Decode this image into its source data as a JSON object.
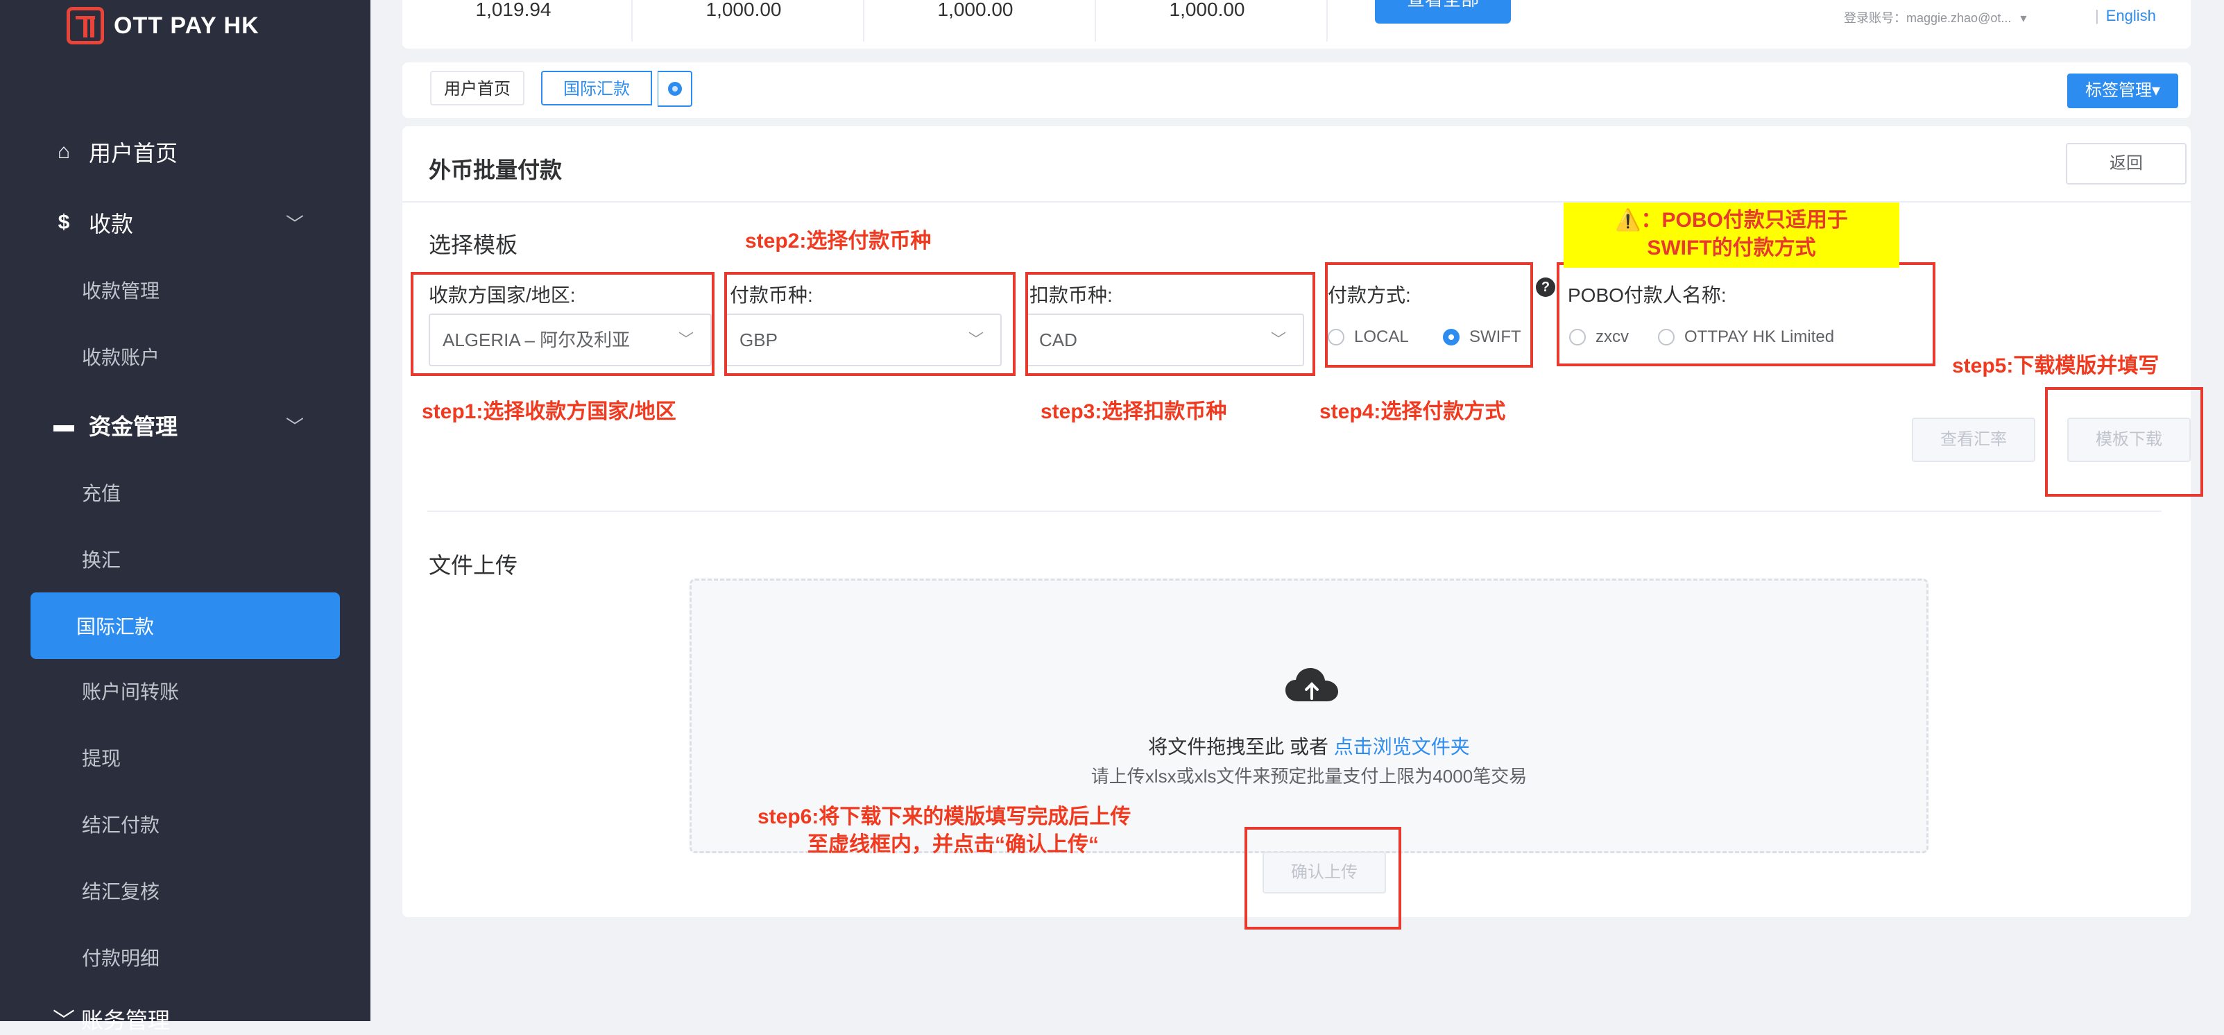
{
  "brand": {
    "name": "OTT PAY HK"
  },
  "sidebar": {
    "groups": [
      {
        "label": "用户首页",
        "icon": "home-icon"
      },
      {
        "label": "收款",
        "icon": "dollar-icon"
      },
      {
        "label": "资金管理",
        "icon": "card-icon"
      },
      {
        "label": "账务管理",
        "icon": "chevron-down-icon"
      }
    ],
    "receive_items": [
      "收款管理",
      "收款账户"
    ],
    "fund_items": [
      "充值",
      "换汇",
      "国际汇款",
      "账户间转账",
      "提现",
      "结汇付款",
      "结汇复核",
      "付款明细"
    ],
    "active": "国际汇款"
  },
  "topbar": {
    "values": [
      "1,019.94",
      "1,000.00",
      "1,000.00",
      "1,000.00"
    ],
    "view_all": "查看全部",
    "account": "登录账号：maggie.zhao@ot...",
    "language": "English"
  },
  "tabs": {
    "items": [
      "用户首页",
      "国际汇款"
    ],
    "tag_manage": "标签管理▾"
  },
  "page": {
    "title": "外币批量付款",
    "back": "返回",
    "select_template": "选择模板",
    "fields": {
      "country_label": "收款方国家/地区:",
      "country_value": "ALGERIA – 阿尔及利亚",
      "pay_currency_label": "付款币种:",
      "pay_currency_value": "GBP",
      "debit_currency_label": "扣款币种:",
      "debit_currency_value": "CAD",
      "pay_method_label": "付款方式:",
      "pay_method_options": [
        "LOCAL",
        "SWIFT"
      ],
      "pay_method_selected": "SWIFT",
      "pobo_label": "POBO付款人名称:",
      "pobo_options": [
        "zxcv",
        "OTTPAY HK Limited"
      ]
    },
    "buttons": {
      "view_rate": "查看汇率",
      "download_template": "模板下载",
      "confirm_upload": "确认上传"
    },
    "upload": {
      "section_title": "文件上传",
      "drag_text": "将文件拖拽至此",
      "or_text": "或者",
      "browse_link": "点击浏览文件夹",
      "hint": "请上传xlsx或xls文件来预定批量支付上限为4000笔交易"
    }
  },
  "annotations": {
    "step1": "step1:选择收款方国家/地区",
    "step2": "step2:选择付款币种",
    "step3": "step3:选择扣款币种",
    "step4": "step4:选择付款方式",
    "step5": "step5:下载模版并填写",
    "step6_line1": "step6:将下载下来的模版填写完成后上传",
    "step6_line2": "至虚线框内，并点击“确认上传“",
    "warning_line1": "⚠️：POBO付款只适用于",
    "warning_line2": "SWIFT的付款方式"
  },
  "colors": {
    "sidebar_bg": "#2b2e3d",
    "accent": "#2d8cf0",
    "annotation_red": "#e8392f",
    "warning_yellow": "#ffff00"
  }
}
